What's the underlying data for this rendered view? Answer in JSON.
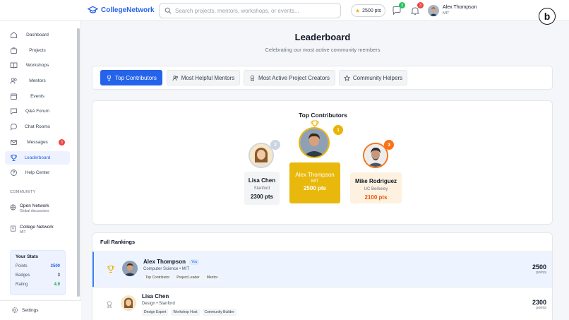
{
  "header": {
    "logo": "CollegeNetwork",
    "search_placeholder": "Search projects, mentors, workshops, or events...",
    "points": "2500 pts",
    "chat_badge": "3",
    "notif_badge": "3",
    "user_name": "Alex Thompson",
    "user_school": "MIT",
    "corner_logo": "b"
  },
  "sidebar": {
    "items": [
      {
        "label": "Dashboard",
        "icon": "home-icon"
      },
      {
        "label": "Projects",
        "icon": "briefcase-icon"
      },
      {
        "label": "Workshops",
        "icon": "book-icon"
      },
      {
        "label": "Mentors",
        "icon": "users-icon"
      },
      {
        "label": "Events",
        "icon": "calendar-icon"
      },
      {
        "label": "Q&A Forum",
        "icon": "chat-icon"
      },
      {
        "label": "Chat Rooms",
        "icon": "chat-bubble-icon"
      },
      {
        "label": "Messages",
        "icon": "mail-icon",
        "badge": "3"
      },
      {
        "label": "Leaderboard",
        "icon": "trophy-icon"
      },
      {
        "label": "Help Center",
        "icon": "help-icon"
      }
    ],
    "community_title": "COMMUNITY",
    "community": [
      {
        "name": "Open Network",
        "sub": "Global discussions"
      },
      {
        "name": "College Network",
        "sub": "MIT"
      }
    ],
    "stats": {
      "title": "Your Stats",
      "rows": [
        {
          "label": "Points",
          "value": "2500",
          "color": "#2563eb"
        },
        {
          "label": "Badges",
          "value": "3",
          "color": "#374151"
        },
        {
          "label": "Rating",
          "value": "4.9",
          "color": "#16a34a"
        }
      ]
    },
    "settings_label": "Settings"
  },
  "main": {
    "title": "Leaderboard",
    "subtitle": "Celebrating our most active community members",
    "tabs": [
      {
        "label": "Top Contributors",
        "icon": "trophy-icon"
      },
      {
        "label": "Most Helpful Mentors",
        "icon": "users-icon"
      },
      {
        "label": "Most Active Project Creators",
        "icon": "medal-icon"
      },
      {
        "label": "Community Helpers",
        "icon": "star-icon"
      }
    ],
    "podium": {
      "title": "Top Contributors",
      "first": {
        "name": "Alex Thompson",
        "school": "MIT",
        "points": "2500 pts",
        "rank": "1"
      },
      "second": {
        "name": "Lisa Chen",
        "school": "Stanford",
        "points": "2300 pts",
        "rank": "2"
      },
      "third": {
        "name": "Mike Rodriguez",
        "school": "UC Berkeley",
        "points": "2100 pts",
        "rank": "3"
      }
    },
    "rankings": {
      "title": "Full Rankings",
      "rows": [
        {
          "name": "Alex Thompson",
          "you": "You",
          "sub": "Computer Science • MIT",
          "tags": [
            "Top Contributor",
            "Project Leader",
            "Mentor"
          ],
          "points": "2500",
          "points_label": "points"
        },
        {
          "name": "Lisa Chen",
          "sub": "Design • Stanford",
          "tags": [
            "Design Expert",
            "Workshop Host",
            "Community Builder"
          ],
          "points": "2300",
          "points_label": "points"
        }
      ]
    }
  }
}
